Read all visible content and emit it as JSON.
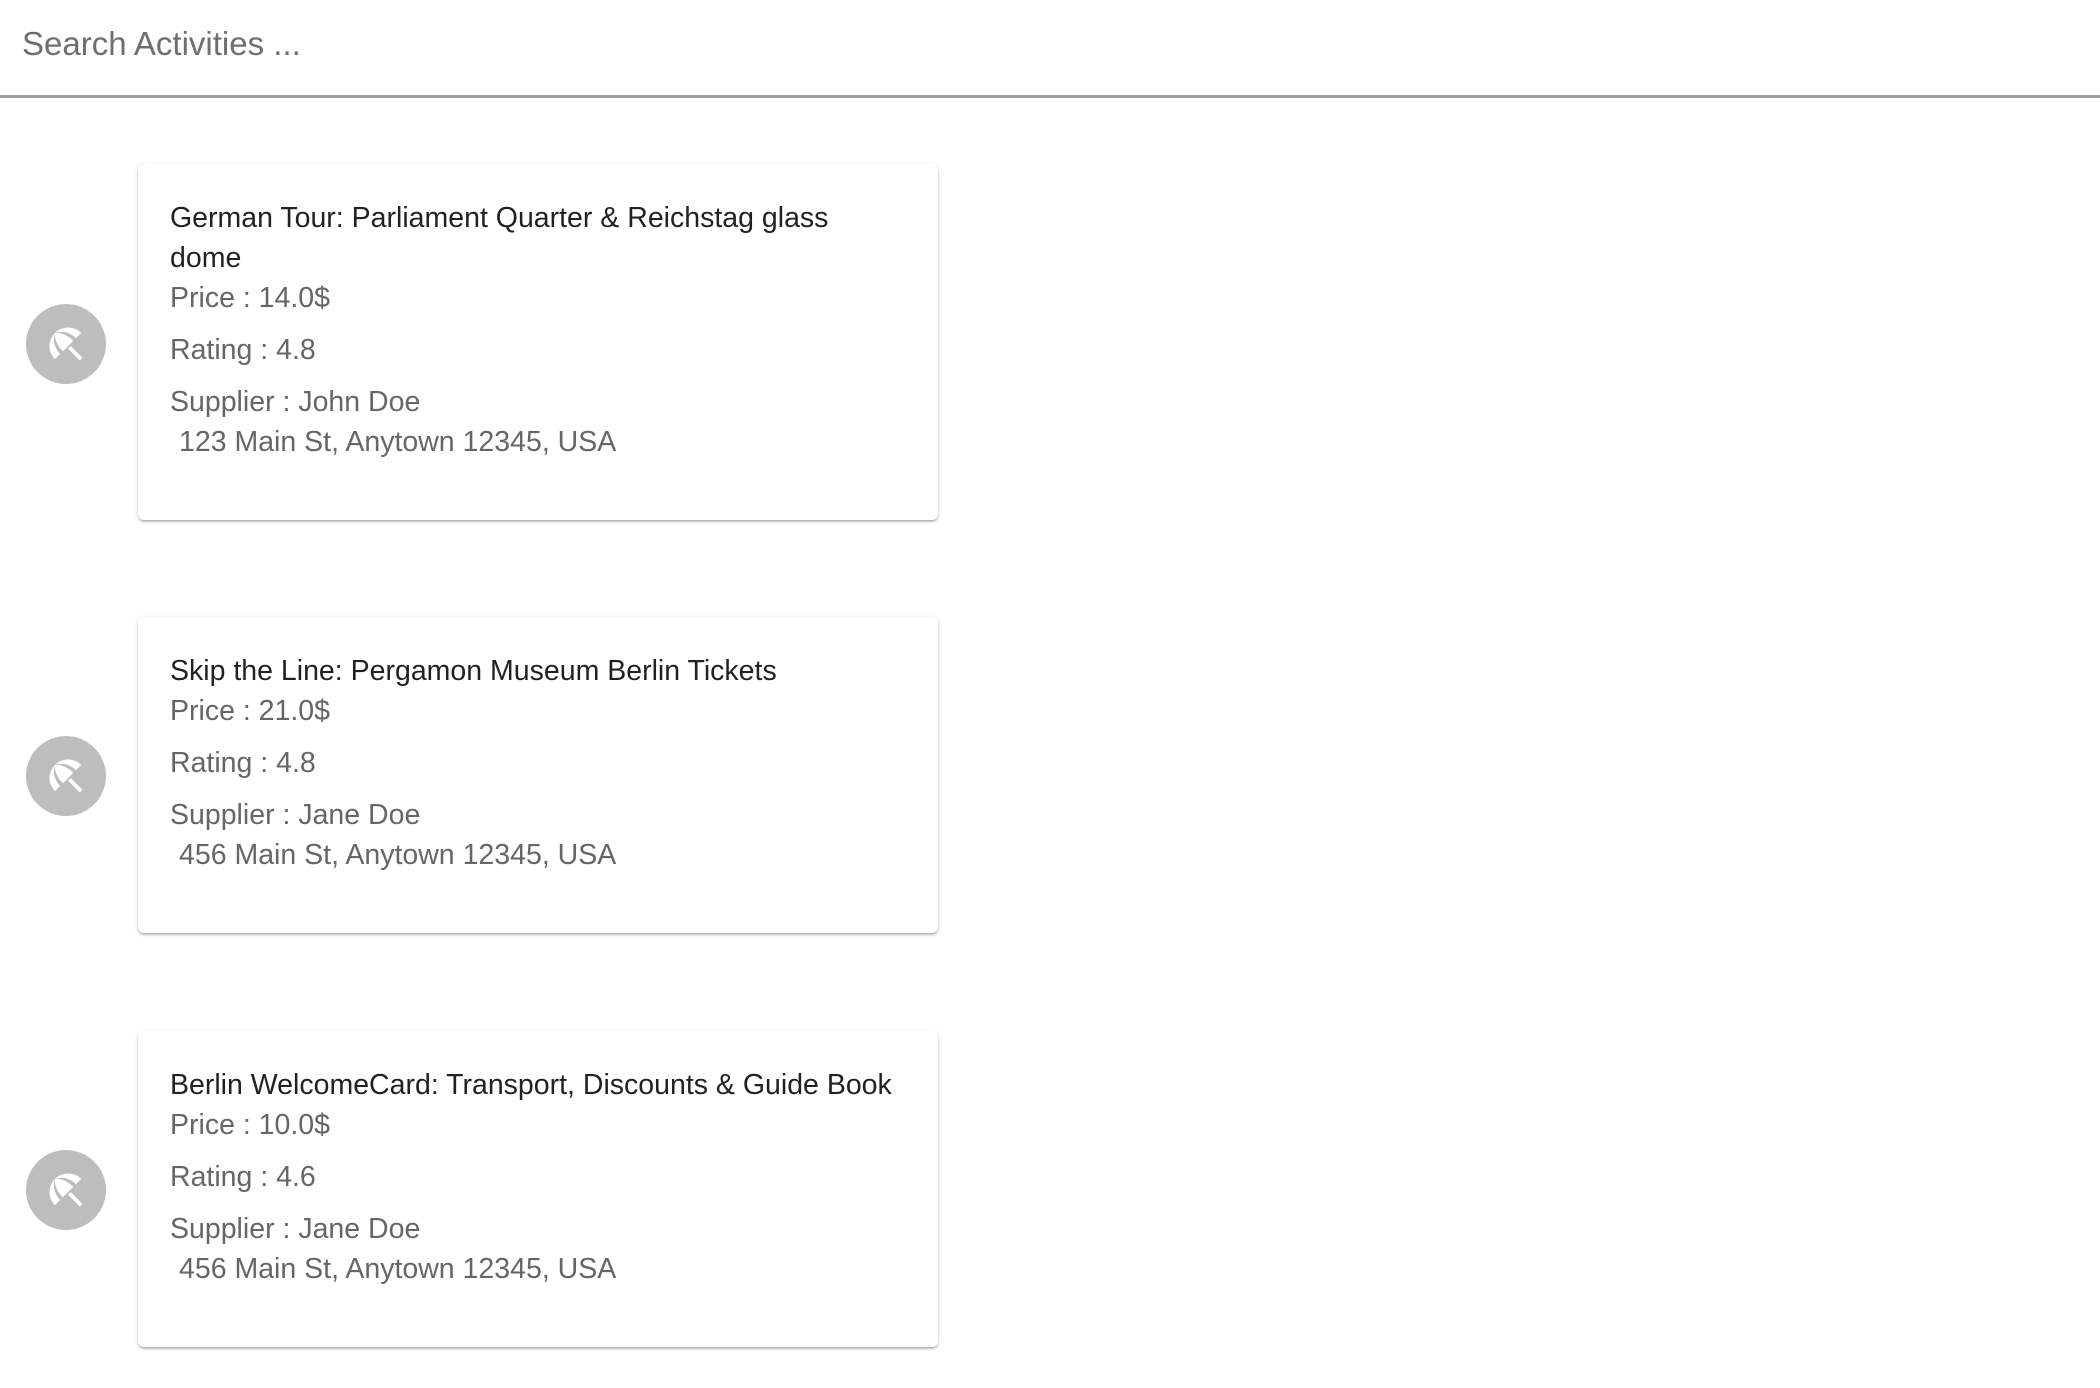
{
  "search": {
    "placeholder": "Search Activities ...",
    "value": ""
  },
  "icons": {
    "activity_avatar": "beach-umbrella-off-icon"
  },
  "colors": {
    "avatar_bg": "#bdbdbd",
    "divider": "#9e9e9e"
  },
  "activities": [
    {
      "title": "German Tour: Parliament Quarter & Reichstag glass dome",
      "price": "Price : 14.0$",
      "rating": "Rating : 4.8",
      "supplier": "Supplier : John Doe",
      "address": "123 Main St, Anytown 12345, USA"
    },
    {
      "title": "Skip the Line: Pergamon Museum Berlin Tickets",
      "price": "Price : 21.0$",
      "rating": "Rating : 4.8",
      "supplier": "Supplier : Jane Doe",
      "address": "456 Main St, Anytown 12345, USA"
    },
    {
      "title": "Berlin WelcomeCard: Transport, Discounts & Guide Book",
      "price": "Price : 10.0$",
      "rating": "Rating : 4.6",
      "supplier": "Supplier : Jane Doe",
      "address": "456 Main St, Anytown 12345, USA"
    }
  ]
}
